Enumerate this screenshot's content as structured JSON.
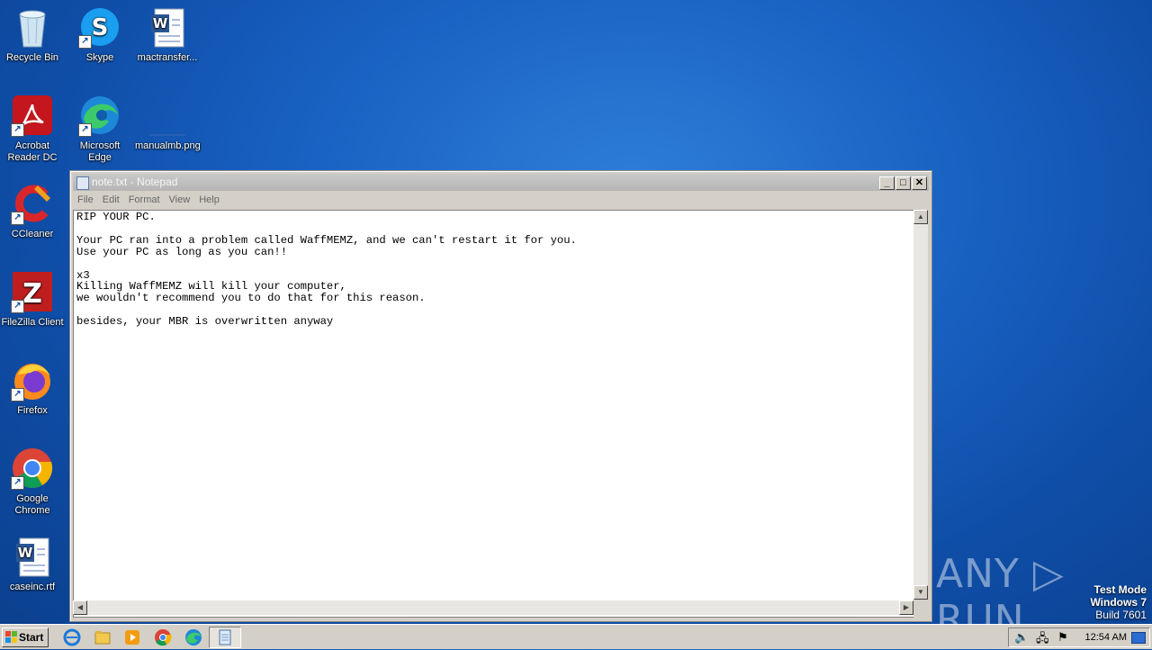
{
  "desktop": {
    "icons": [
      {
        "label": "Recycle Bin",
        "icon": "recycle-bin-icon"
      },
      {
        "label": "Skype",
        "icon": "skype-icon"
      },
      {
        "label": "mactransfer...",
        "icon": "word-document-icon"
      },
      {
        "label": "Acrobat Reader DC",
        "icon": "acrobat-icon"
      },
      {
        "label": "Microsoft Edge",
        "icon": "edge-icon"
      },
      {
        "label": "manualmb.png",
        "icon": "image-file-icon"
      },
      {
        "label": "CCleaner",
        "icon": "ccleaner-icon"
      },
      {
        "label": "FileZilla Client",
        "icon": "filezilla-icon"
      },
      {
        "label": "Firefox",
        "icon": "firefox-icon"
      },
      {
        "label": "Google Chrome",
        "icon": "chrome-icon"
      },
      {
        "label": "caseinc.rtf",
        "icon": "word-document-icon"
      }
    ]
  },
  "notepad": {
    "title": "note.txt - Notepad",
    "menu": [
      "File",
      "Edit",
      "Format",
      "View",
      "Help"
    ],
    "content": "RIP YOUR PC.\n\nYour PC ran into a problem called WaffMEMZ, and we can't restart it for you.\nUse your PC as long as you can!!\n\nx3\nKilling WaffMEMZ will kill your computer,\nwe wouldn't recommend you to do that for this reason.\n\nbesides, your MBR is overwritten anyway",
    "minimize": "_",
    "maximize": "□",
    "close": "✕"
  },
  "watermark": "ANY ▷ RUN",
  "test_mode": {
    "line1": "Test Mode",
    "line2": "Windows 7",
    "line3": "Build 7601"
  },
  "taskbar": {
    "start_label": "Start",
    "pinned": [
      "internet-explorer-icon",
      "file-explorer-icon",
      "media-player-icon",
      "chrome-icon",
      "edge-icon",
      "notepad-icon"
    ],
    "clock": "12:54 AM"
  }
}
